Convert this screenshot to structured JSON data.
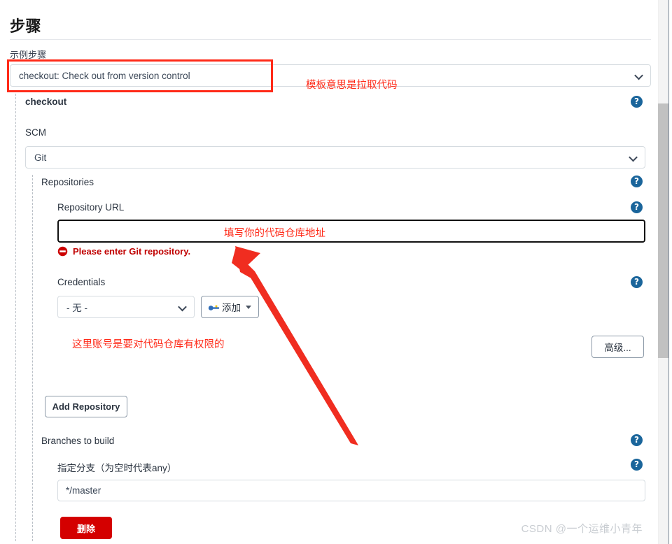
{
  "header": {
    "title": "步骤",
    "subtitle": "示例步骤"
  },
  "step_select": {
    "value": "checkout: Check out from version control",
    "caption": "checkout"
  },
  "scm": {
    "label": "SCM",
    "value": "Git"
  },
  "repositories": {
    "label": "Repositories",
    "url_label": "Repository URL",
    "url_value": "",
    "url_placeholder": "",
    "error": "Please enter Git repository.",
    "credentials_label": "Credentials",
    "credentials_value": "- 无 -",
    "add_credentials_label": "添加",
    "advanced_label": "高级...",
    "add_repository_label": "Add Repository"
  },
  "branches": {
    "label": "Branches to build",
    "field_label": "指定分支（为空时代表any）",
    "value": "*/master"
  },
  "actions": {
    "delete_label": "删除"
  },
  "annotations": {
    "template_note": "模板意思是拉取代码",
    "repo_note": "填写你的代码仓库地址",
    "credentials_note": "这里账号是要对代码仓库有权限的"
  },
  "icons": {
    "help": "?",
    "help_name": "help-icon",
    "key_name": "key-icon",
    "error_name": "error-circle-icon",
    "chevron_name": "chevron-down-icon"
  },
  "colors": {
    "accent_red": "#ff2a18",
    "help_blue": "#1a659b",
    "danger": "#d40000",
    "error_text": "#c00000"
  },
  "watermark": "CSDN @一个运维小青年"
}
